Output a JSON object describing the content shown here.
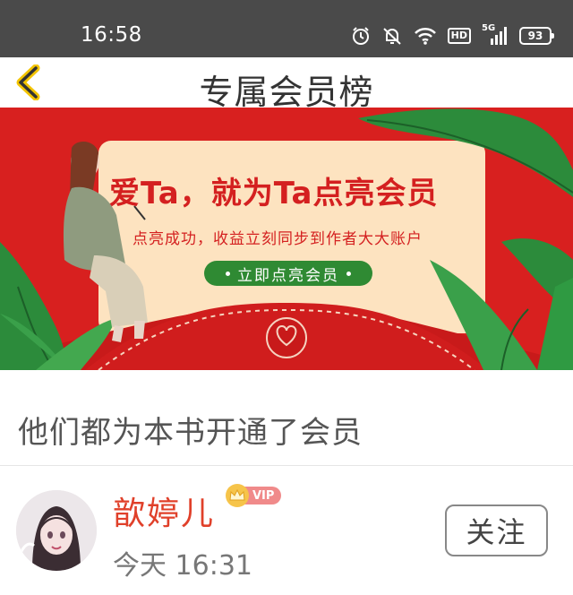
{
  "status_bar": {
    "time": "16:58",
    "network_badge": "HD",
    "signal_label": "5G",
    "battery_level": "93"
  },
  "header": {
    "title": "专属会员榜",
    "back_icon": "chevron-left-icon"
  },
  "banner": {
    "headline": "爱Ta，就为Ta点亮会员",
    "subtitle": "点亮成功，收益立刻同步到作者大大账户",
    "cta_label": "立即点亮会员"
  },
  "section": {
    "title": "他们都为本书开通了会员"
  },
  "members": [
    {
      "name": "歆婷儿",
      "badge": "VIP",
      "time": "今天 16:31",
      "follow_label": "关注"
    }
  ],
  "colors": {
    "status_bar_bg": "#4a4a4a",
    "banner_red": "#d8201f",
    "banner_green": "#2f8a33",
    "name_color": "#e0402a",
    "vip_pink": "#f08a8a",
    "crown_gold": "#f6c44a"
  }
}
